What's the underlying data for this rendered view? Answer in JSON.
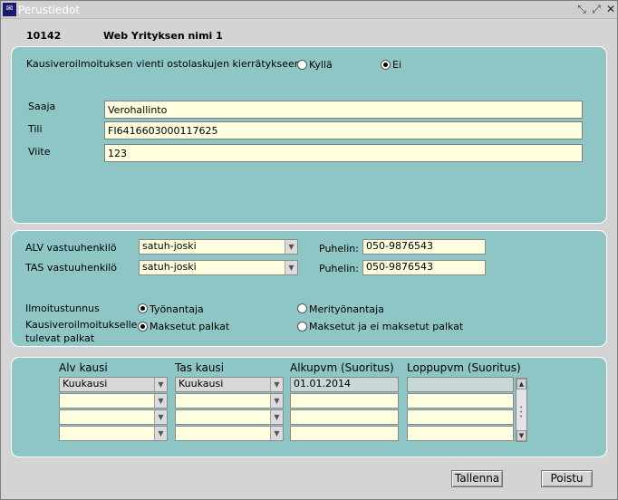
{
  "window": {
    "title": "Perustiedot",
    "app_icon": "app-icon"
  },
  "header": {
    "company_id": "10142",
    "company_name": "Web Yrityksen nimi 1"
  },
  "payment": {
    "question": "Kausiveroilmoituksen vienti ostolaskujen kierrätykseen",
    "option_yes": "Kyllä",
    "option_no": "Ei",
    "selected": "Ei",
    "recipient_label": "Saaja",
    "recipient_value": "Verohallinto",
    "account_label": "Tili",
    "account_value": "FI6416603000117625",
    "reference_label": "Viite",
    "reference_value": "123"
  },
  "contacts": {
    "alv_label": "ALV vastuuhenkilö",
    "alv_person": "satuh-joski",
    "alv_phone_label": "Puhelin:",
    "alv_phone": "050-9876543",
    "tas_label": "TAS vastuuhenkilö",
    "tas_person": "satuh-joski",
    "tas_phone_label": "Puhelin:",
    "tas_phone": "050-9876543",
    "id_label": "Ilmoitustunnus",
    "id_option1": "Työnantaja",
    "id_option2": "Merityönantaja",
    "id_selected": "Työnantaja",
    "wages_label_line1": "Kausiveroilmoitukselle",
    "wages_label_line2": "tulevat palkat",
    "wages_option1": "Maksetut palkat",
    "wages_option2": "Maksetut ja ei maksetut palkat",
    "wages_selected": "Maksetut palkat"
  },
  "periods": {
    "headers": [
      "Alv kausi",
      "Tas kausi",
      "Alkupvm (Suoritus)",
      "Loppupvm (Suoritus)"
    ],
    "rows": [
      [
        "Kuukausi",
        "Kuukausi",
        "01.01.2014",
        ""
      ],
      [
        "",
        "",
        "",
        ""
      ],
      [
        "",
        "",
        "",
        ""
      ],
      [
        "",
        "",
        "",
        ""
      ]
    ]
  },
  "footer": {
    "save_label": "Tallenna",
    "exit_label": "Poistu"
  }
}
